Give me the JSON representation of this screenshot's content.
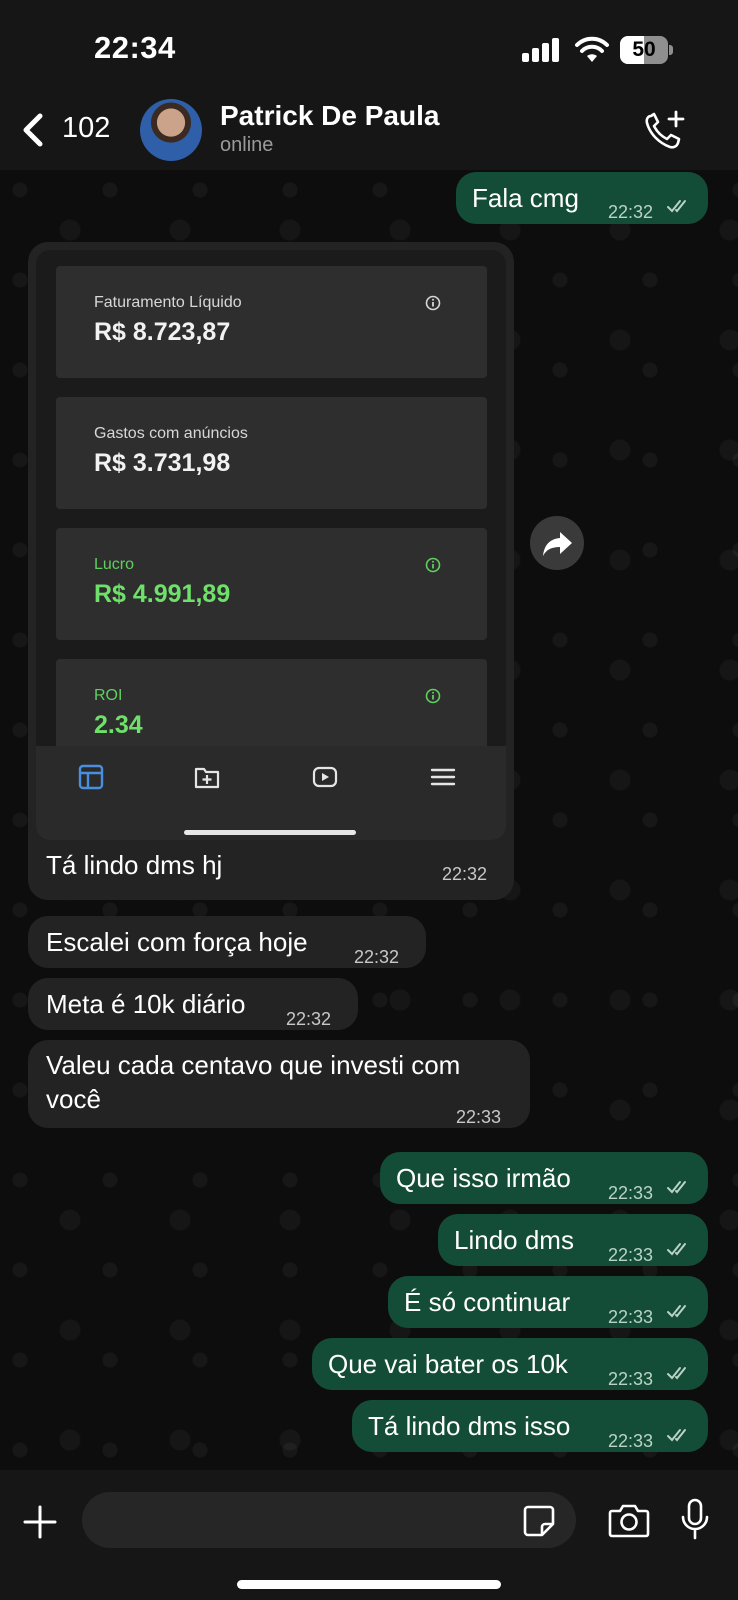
{
  "status_bar": {
    "time": "22:34",
    "battery": "50",
    "battery_fraction": 0.5,
    "icons": [
      "signal-icon",
      "wifi-icon",
      "battery-icon"
    ]
  },
  "header": {
    "back_count": "102",
    "contact_name": "Patrick De Paula",
    "contact_status": "online",
    "icons": [
      "chevron-left-icon",
      "avatar",
      "add-call-icon"
    ]
  },
  "screenshot_message": {
    "cards": [
      {
        "label": "Faturamento Líquido",
        "value": "R$ 8.723,87",
        "info": true
      },
      {
        "label": "Gastos com anúncios",
        "value": "R$ 3.731,98",
        "info": false
      },
      {
        "label": "Lucro",
        "value": "R$ 4.991,89",
        "info": true
      },
      {
        "label": "ROI",
        "value": "2.34",
        "info": true
      }
    ],
    "tab_icons": [
      "dashboard-icon",
      "folder-plus-icon",
      "play-icon",
      "menu-icon"
    ],
    "caption": "Tá lindo dms hj",
    "time": "22:32"
  },
  "messages": [
    {
      "direction": "out",
      "text": "Fala cmg",
      "time": "22:32",
      "read": true
    },
    {
      "direction": "in",
      "text": "Escalei com força hoje",
      "time": "22:32"
    },
    {
      "direction": "in",
      "text": "Meta é 10k diário",
      "time": "22:32"
    },
    {
      "direction": "in",
      "text": "Valeu cada centavo que investi com você",
      "time": "22:33"
    },
    {
      "direction": "out",
      "text": "Que isso irmão",
      "time": "22:33",
      "read": true
    },
    {
      "direction": "out",
      "text": "Lindo dms",
      "time": "22:33",
      "read": true
    },
    {
      "direction": "out",
      "text": "É só continuar",
      "time": "22:33",
      "read": true
    },
    {
      "direction": "out",
      "text": "Que vai bater os 10k",
      "time": "22:33",
      "read": true
    },
    {
      "direction": "out",
      "text": "Tá lindo dms isso",
      "time": "22:33",
      "read": true
    }
  ],
  "input_bar": {
    "placeholder": "",
    "icons": [
      "plus-icon",
      "sticker-icon",
      "camera-icon",
      "mic-icon"
    ]
  },
  "colors": {
    "outgoing_bubble": "#144d37",
    "incoming_bubble": "#232323",
    "chat_background": "#0d0d0d",
    "bars": "#161616",
    "profit_green": "#6fe06a"
  }
}
